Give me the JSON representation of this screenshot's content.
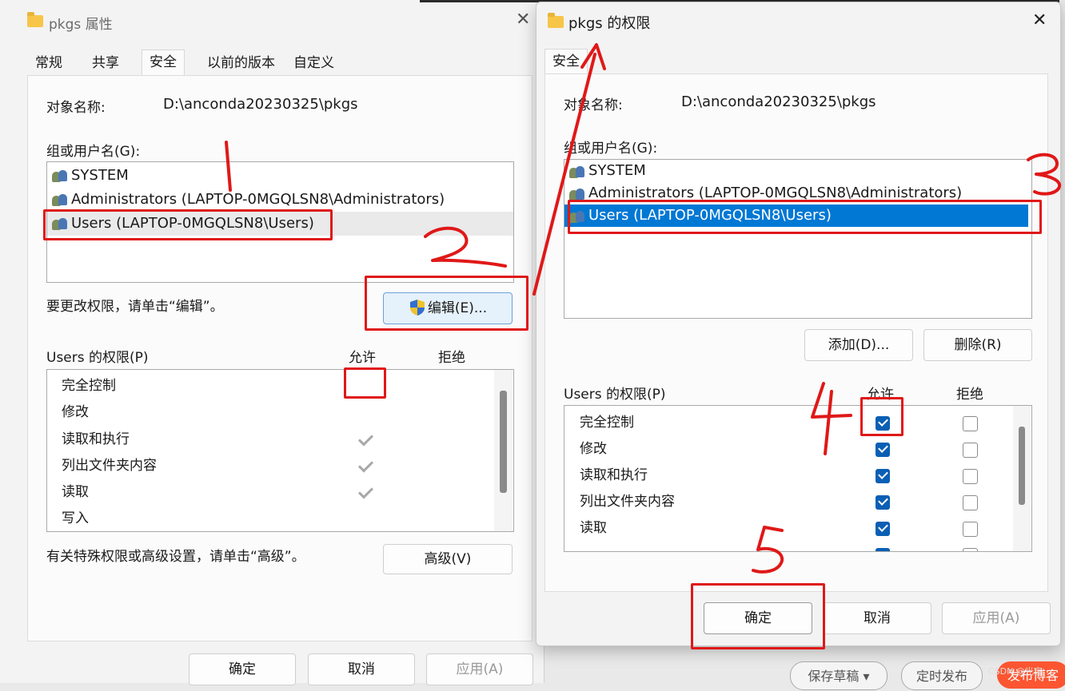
{
  "left": {
    "title": "pkgs 属性",
    "tabs": [
      "常规",
      "共享",
      "安全",
      "以前的版本",
      "自定义"
    ],
    "object_label": "对象名称:",
    "object_value": "D:\\anconda20230325\\pkgs",
    "group_label": "组或用户名(G):",
    "users": [
      "SYSTEM",
      "Administrators (LAPTOP-0MGQLSN8\\Administrators)",
      "Users (LAPTOP-0MGQLSN8\\Users)"
    ],
    "edit_hint": "要更改权限，请单击“编辑”。",
    "edit_button": "编辑(E)...",
    "perm_title": "Users 的权限(P)",
    "allow": "允许",
    "deny": "拒绝",
    "permissions": [
      "完全控制",
      "修改",
      "读取和执行",
      "列出文件夹内容",
      "读取",
      "写入"
    ],
    "advanced_hint": "有关特殊权限或高级设置，请单击“高级”。",
    "advanced_button": "高级(V)",
    "ok": "确定",
    "cancel": "取消",
    "apply": "应用(A)"
  },
  "right": {
    "title": "pkgs 的权限",
    "tab": "安全",
    "object_label": "对象名称:",
    "object_value": "D:\\anconda20230325\\pkgs",
    "group_label": "组或用户名(G):",
    "users": [
      "SYSTEM",
      "Administrators (LAPTOP-0MGQLSN8\\Administrators)",
      "Users (LAPTOP-0MGQLSN8\\Users)"
    ],
    "add_button": "添加(D)...",
    "remove_button": "删除(R)",
    "perm_title": "Users 的权限(P)",
    "allow": "允许",
    "deny": "拒绝",
    "permissions": [
      "完全控制",
      "修改",
      "读取和执行",
      "列出文件夹内容",
      "读取"
    ],
    "ok": "确定",
    "cancel": "取消",
    "apply": "应用(A)"
  },
  "background": {
    "save_draft": "保存草稿",
    "schedule": "定时发布",
    "publish": "发布博客",
    "watermark": "CSDN @光宇"
  },
  "annotations": [
    "1",
    "2",
    "3",
    "4",
    "5"
  ],
  "colors": {
    "accent": "#0a5fb4",
    "highlight": "#0078d4",
    "annotation": "#e01818"
  }
}
